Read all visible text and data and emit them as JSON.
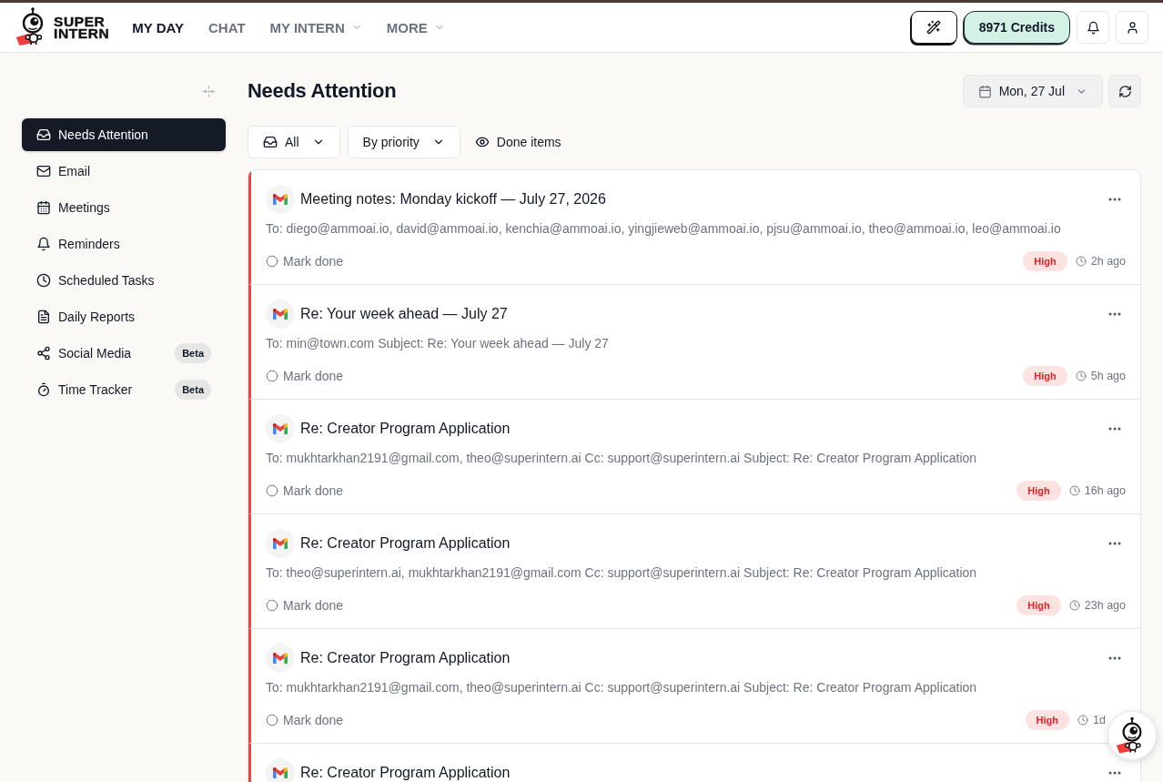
{
  "header": {
    "logo": {
      "wordmark": "SUPER INTERN"
    },
    "nav": [
      {
        "label": "MY DAY",
        "selected": true,
        "dropdown": false
      },
      {
        "label": "CHAT",
        "selected": false,
        "dropdown": false
      },
      {
        "label": "MY INTERN",
        "selected": false,
        "dropdown": true
      },
      {
        "label": "MORE",
        "selected": false,
        "dropdown": true
      }
    ],
    "credits": "8971 Credits"
  },
  "sidebar": {
    "items": [
      {
        "label": "Needs Attention",
        "selected": true
      },
      {
        "label": "Email",
        "selected": false
      },
      {
        "label": "Meetings",
        "selected": false
      },
      {
        "label": "Reminders",
        "selected": false
      },
      {
        "label": "Scheduled Tasks",
        "selected": false
      },
      {
        "label": "Daily Reports",
        "selected": false
      },
      {
        "label": "Social Media",
        "selected": false,
        "badge": "Beta"
      },
      {
        "label": "Time Tracker",
        "selected": false,
        "badge": "Beta"
      }
    ]
  },
  "main": {
    "title": "Needs Attention",
    "date": "Mon, 27 Jul",
    "filter": "All",
    "sort": "By priority",
    "done_toggle": "Done items",
    "items": [
      {
        "title": "Meeting notes: Monday kickoff — July 27, 2026",
        "recipients": "To: diego@ammoai.io, david@ammoai.io, kenchia@ammoai.io, yingjieweb@ammoai.io, pjsu@ammoai.io, theo@ammoai.io, leo@ammoai.io",
        "action": "Mark done",
        "done": false,
        "priority": "High",
        "time": "2h ago"
      },
      {
        "title": "Re: Your week ahead — July 27",
        "recipients": "To: min@town.com Subject: Re: Your week ahead — July 27",
        "action": "Mark done",
        "done": false,
        "priority": "High",
        "time": "5h ago"
      },
      {
        "title": "Re: Creator Program Application",
        "recipients": "To: mukhtarkhan2191@gmail.com, theo@superintern.ai Cc: support@superintern.ai Subject: Re: Creator Program Application",
        "action": "Mark done",
        "done": false,
        "priority": "High",
        "time": "16h ago"
      },
      {
        "title": "Re: Creator Program Application",
        "recipients": "To: theo@superintern.ai, mukhtarkhan2191@gmail.com Cc: support@superintern.ai Subject: Re: Creator Program Application",
        "action": "Mark done",
        "done": false,
        "priority": "High",
        "time": "23h ago"
      },
      {
        "title": "Re: Creator Program Application",
        "recipients": "To: mukhtarkhan2191@gmail.com, theo@superintern.ai Cc: support@superintern.ai Subject: Re: Creator Program Application",
        "action": "Mark done",
        "done": false,
        "priority": "High",
        "time": "1d"
      },
      {
        "title": "Re: Creator Program Application"
      }
    ]
  }
}
